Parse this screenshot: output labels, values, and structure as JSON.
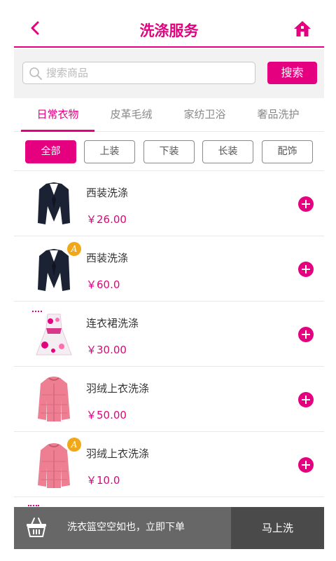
{
  "header": {
    "title": "洗涤服务",
    "back_icon": "chevron-left-icon",
    "home_icon": "home-icon"
  },
  "search": {
    "placeholder": "搜索商品",
    "button_label": "搜索"
  },
  "category_tabs": [
    "日常衣物",
    "皮革毛绒",
    "家纺卫浴",
    "奢品洗护"
  ],
  "active_category": "日常衣物",
  "filters": [
    "全部",
    "上装",
    "下装",
    "长装",
    "配饰"
  ],
  "active_filter": "全部",
  "items": [
    {
      "name": "西装洗涤",
      "price": "￥26.00",
      "image": "suit-jacket-image",
      "badge": ""
    },
    {
      "name": "西装洗涤",
      "price": "￥60.0",
      "image": "suit-jacket-image",
      "badge": "A"
    },
    {
      "name": "连衣裙洗涤",
      "price": "￥30.00",
      "image": "floral-dress-image",
      "badge": ""
    },
    {
      "name": "羽绒上衣洗涤",
      "price": "￥50.00",
      "image": "pink-down-jacket-image",
      "badge": ""
    },
    {
      "name": "羽绒上衣洗涤",
      "price": "￥10.0",
      "image": "pink-down-jacket-image",
      "badge": "A"
    }
  ],
  "cart": {
    "message": "洗衣篮空空如也，立即下单",
    "action_label": "马上洗",
    "icon": "basket-icon"
  },
  "colors": {
    "accent": "#e4007f",
    "badge": "#f0a81a",
    "cart_bg": "#4a4a4a"
  }
}
